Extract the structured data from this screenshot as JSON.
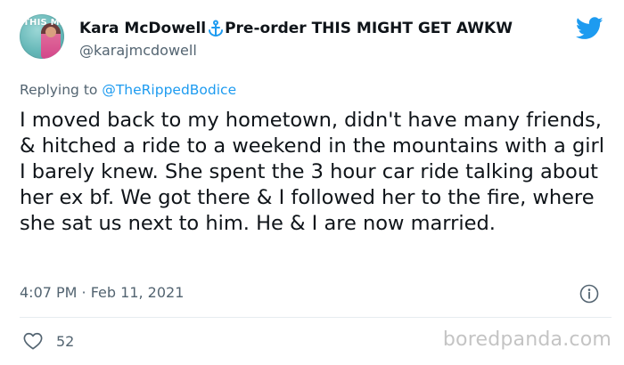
{
  "author": {
    "display_name": "Kara McDowell",
    "name_suffix": "Pre-order THIS MIGHT GET AWKW",
    "handle": "@karajmcdowell",
    "avatar_text": "THIS MIGHT GET AWKW"
  },
  "reply": {
    "prefix": "Replying to",
    "mention": "@TheRippedBodice"
  },
  "tweet": {
    "text": "I moved back to my hometown, didn't have many friends, & hitched a ride to a weekend in the mountains with a girl I barely knew. She spent the 3 hour car ride talking about her ex bf. We got there & I followed her to the fire, where she sat us next to him. He & I are now married.",
    "timestamp": "4:07 PM · Feb 11, 2021",
    "likes": "52"
  },
  "watermark": "boredpanda.com",
  "icons": {
    "anchor": "anchor-icon",
    "bird": "twitter-bird-icon",
    "info": "info-icon",
    "heart": "heart-icon"
  },
  "colors": {
    "brand_blue": "#1d9bf0",
    "secondary_text": "#536471",
    "primary_text": "#0f1419",
    "watermark": "#c4c4c4"
  }
}
